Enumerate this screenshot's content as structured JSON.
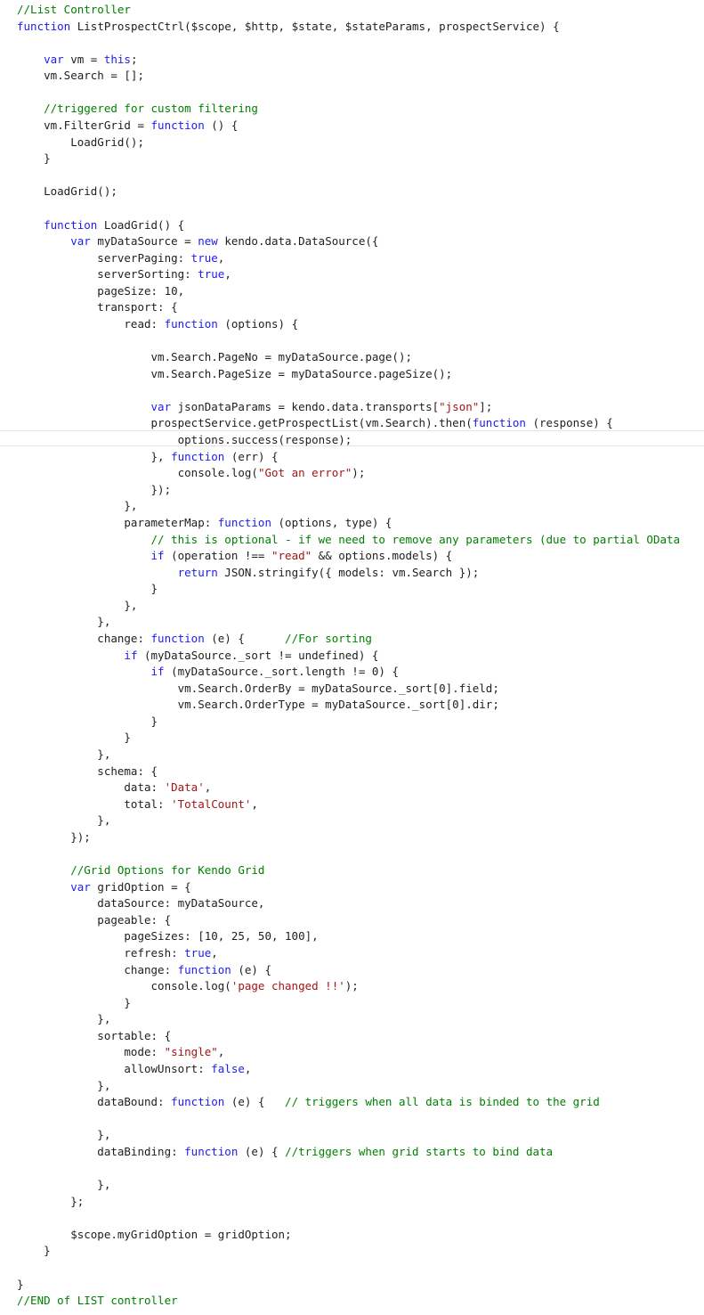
{
  "editor": {
    "colors": {
      "keyword": "#1c1cf0",
      "string": "#a31515",
      "comment": "#008000",
      "plain": "#1e1e1e",
      "background": "#ffffff",
      "current_line_border": "#e6e6e6"
    },
    "current_line_index": 26,
    "lines": [
      [
        {
          "t": "com",
          "v": "//List Controller"
        }
      ],
      [
        {
          "t": "kw",
          "v": "function"
        },
        {
          "t": "pl",
          "v": " ListProspectCtrl($scope, $http, $state, $stateParams, prospectService) {"
        }
      ],
      [],
      [
        {
          "t": "pl",
          "v": "    "
        },
        {
          "t": "kw",
          "v": "var"
        },
        {
          "t": "pl",
          "v": " vm = "
        },
        {
          "t": "kw",
          "v": "this"
        },
        {
          "t": "pl",
          "v": ";"
        }
      ],
      [
        {
          "t": "pl",
          "v": "    vm.Search = [];"
        }
      ],
      [],
      [
        {
          "t": "pl",
          "v": "    "
        },
        {
          "t": "com",
          "v": "//triggered for custom filtering"
        }
      ],
      [
        {
          "t": "pl",
          "v": "    vm.FilterGrid = "
        },
        {
          "t": "kw",
          "v": "function"
        },
        {
          "t": "pl",
          "v": " () {"
        }
      ],
      [
        {
          "t": "pl",
          "v": "        LoadGrid();"
        }
      ],
      [
        {
          "t": "pl",
          "v": "    }"
        }
      ],
      [],
      [
        {
          "t": "pl",
          "v": "    LoadGrid();"
        }
      ],
      [],
      [
        {
          "t": "pl",
          "v": "    "
        },
        {
          "t": "kw",
          "v": "function"
        },
        {
          "t": "pl",
          "v": " LoadGrid() {"
        }
      ],
      [
        {
          "t": "pl",
          "v": "        "
        },
        {
          "t": "kw",
          "v": "var"
        },
        {
          "t": "pl",
          "v": " myDataSource = "
        },
        {
          "t": "kw",
          "v": "new"
        },
        {
          "t": "pl",
          "v": " kendo.data.DataSource({"
        }
      ],
      [
        {
          "t": "pl",
          "v": "            serverPaging: "
        },
        {
          "t": "kw",
          "v": "true"
        },
        {
          "t": "pl",
          "v": ","
        }
      ],
      [
        {
          "t": "pl",
          "v": "            serverSorting: "
        },
        {
          "t": "kw",
          "v": "true"
        },
        {
          "t": "pl",
          "v": ","
        }
      ],
      [
        {
          "t": "pl",
          "v": "            pageSize: 10,"
        }
      ],
      [
        {
          "t": "pl",
          "v": "            transport: {"
        }
      ],
      [
        {
          "t": "pl",
          "v": "                read: "
        },
        {
          "t": "kw",
          "v": "function"
        },
        {
          "t": "pl",
          "v": " (options) {"
        }
      ],
      [],
      [
        {
          "t": "pl",
          "v": "                    vm.Search.PageNo = myDataSource.page();"
        }
      ],
      [
        {
          "t": "pl",
          "v": "                    vm.Search.PageSize = myDataSource.pageSize();"
        }
      ],
      [],
      [
        {
          "t": "pl",
          "v": "                    "
        },
        {
          "t": "kw",
          "v": "var"
        },
        {
          "t": "pl",
          "v": " jsonDataParams = kendo.data.transports["
        },
        {
          "t": "str",
          "v": "\"json\""
        },
        {
          "t": "pl",
          "v": "];"
        }
      ],
      [
        {
          "t": "pl",
          "v": "                    prospectService.getProspectList(vm.Search).then("
        },
        {
          "t": "kw",
          "v": "function"
        },
        {
          "t": "pl",
          "v": " (response) {"
        }
      ],
      [
        {
          "t": "pl",
          "v": "                        options.success(response);"
        }
      ],
      [
        {
          "t": "pl",
          "v": "                    }, "
        },
        {
          "t": "kw",
          "v": "function"
        },
        {
          "t": "pl",
          "v": " (err) {"
        }
      ],
      [
        {
          "t": "pl",
          "v": "                        console.log("
        },
        {
          "t": "str",
          "v": "\"Got an error\""
        },
        {
          "t": "pl",
          "v": ");"
        }
      ],
      [
        {
          "t": "pl",
          "v": "                    });"
        }
      ],
      [
        {
          "t": "pl",
          "v": "                },"
        }
      ],
      [
        {
          "t": "pl",
          "v": "                parameterMap: "
        },
        {
          "t": "kw",
          "v": "function"
        },
        {
          "t": "pl",
          "v": " (options, type) {"
        }
      ],
      [
        {
          "t": "pl",
          "v": "                    "
        },
        {
          "t": "com",
          "v": "// this is optional - if we need to remove any parameters (due to partial OData"
        }
      ],
      [
        {
          "t": "pl",
          "v": "                    "
        },
        {
          "t": "kw",
          "v": "if"
        },
        {
          "t": "pl",
          "v": " (operation !== "
        },
        {
          "t": "str",
          "v": "\"read\""
        },
        {
          "t": "pl",
          "v": " && options.models) {"
        }
      ],
      [
        {
          "t": "pl",
          "v": "                        "
        },
        {
          "t": "kw",
          "v": "return"
        },
        {
          "t": "pl",
          "v": " JSON.stringify({ models: vm.Search });"
        }
      ],
      [
        {
          "t": "pl",
          "v": "                    }"
        }
      ],
      [
        {
          "t": "pl",
          "v": "                },"
        }
      ],
      [
        {
          "t": "pl",
          "v": "            },"
        }
      ],
      [
        {
          "t": "pl",
          "v": "            change: "
        },
        {
          "t": "kw",
          "v": "function"
        },
        {
          "t": "pl",
          "v": " (e) {      "
        },
        {
          "t": "com",
          "v": "//For sorting"
        }
      ],
      [
        {
          "t": "pl",
          "v": "                "
        },
        {
          "t": "kw",
          "v": "if"
        },
        {
          "t": "pl",
          "v": " (myDataSource._sort != undefined) {"
        }
      ],
      [
        {
          "t": "pl",
          "v": "                    "
        },
        {
          "t": "kw",
          "v": "if"
        },
        {
          "t": "pl",
          "v": " (myDataSource._sort.length != 0) {"
        }
      ],
      [
        {
          "t": "pl",
          "v": "                        vm.Search.OrderBy = myDataSource._sort[0].field;"
        }
      ],
      [
        {
          "t": "pl",
          "v": "                        vm.Search.OrderType = myDataSource._sort[0].dir;"
        }
      ],
      [
        {
          "t": "pl",
          "v": "                    }"
        }
      ],
      [
        {
          "t": "pl",
          "v": "                }"
        }
      ],
      [
        {
          "t": "pl",
          "v": "            },"
        }
      ],
      [
        {
          "t": "pl",
          "v": "            schema: {"
        }
      ],
      [
        {
          "t": "pl",
          "v": "                data: "
        },
        {
          "t": "str",
          "v": "'Data'"
        },
        {
          "t": "pl",
          "v": ","
        }
      ],
      [
        {
          "t": "pl",
          "v": "                total: "
        },
        {
          "t": "str",
          "v": "'TotalCount'"
        },
        {
          "t": "pl",
          "v": ","
        }
      ],
      [
        {
          "t": "pl",
          "v": "            },"
        }
      ],
      [
        {
          "t": "pl",
          "v": "        });"
        }
      ],
      [],
      [
        {
          "t": "pl",
          "v": "        "
        },
        {
          "t": "com",
          "v": "//Grid Options for Kendo Grid"
        }
      ],
      [
        {
          "t": "pl",
          "v": "        "
        },
        {
          "t": "kw",
          "v": "var"
        },
        {
          "t": "pl",
          "v": " gridOption = {"
        }
      ],
      [
        {
          "t": "pl",
          "v": "            dataSource: myDataSource,"
        }
      ],
      [
        {
          "t": "pl",
          "v": "            pageable: {"
        }
      ],
      [
        {
          "t": "pl",
          "v": "                pageSizes: [10, 25, 50, 100],"
        }
      ],
      [
        {
          "t": "pl",
          "v": "                refresh: "
        },
        {
          "t": "kw",
          "v": "true"
        },
        {
          "t": "pl",
          "v": ","
        }
      ],
      [
        {
          "t": "pl",
          "v": "                change: "
        },
        {
          "t": "kw",
          "v": "function"
        },
        {
          "t": "pl",
          "v": " (e) {"
        }
      ],
      [
        {
          "t": "pl",
          "v": "                    console.log("
        },
        {
          "t": "str",
          "v": "'page changed !!'"
        },
        {
          "t": "pl",
          "v": ");"
        }
      ],
      [
        {
          "t": "pl",
          "v": "                }"
        }
      ],
      [
        {
          "t": "pl",
          "v": "            },"
        }
      ],
      [
        {
          "t": "pl",
          "v": "            sortable: {"
        }
      ],
      [
        {
          "t": "pl",
          "v": "                mode: "
        },
        {
          "t": "str",
          "v": "\"single\""
        },
        {
          "t": "pl",
          "v": ","
        }
      ],
      [
        {
          "t": "pl",
          "v": "                allowUnsort: "
        },
        {
          "t": "kw",
          "v": "false"
        },
        {
          "t": "pl",
          "v": ","
        }
      ],
      [
        {
          "t": "pl",
          "v": "            },"
        }
      ],
      [
        {
          "t": "pl",
          "v": "            dataBound: "
        },
        {
          "t": "kw",
          "v": "function"
        },
        {
          "t": "pl",
          "v": " (e) {   "
        },
        {
          "t": "com",
          "v": "// triggers when all data is binded to the grid"
        }
      ],
      [],
      [
        {
          "t": "pl",
          "v": "            },"
        }
      ],
      [
        {
          "t": "pl",
          "v": "            dataBinding: "
        },
        {
          "t": "kw",
          "v": "function"
        },
        {
          "t": "pl",
          "v": " (e) { "
        },
        {
          "t": "com",
          "v": "//triggers when grid starts to bind data"
        }
      ],
      [],
      [
        {
          "t": "pl",
          "v": "            },"
        }
      ],
      [
        {
          "t": "pl",
          "v": "        };"
        }
      ],
      [],
      [
        {
          "t": "pl",
          "v": "        $scope.myGridOption = gridOption;"
        }
      ],
      [
        {
          "t": "pl",
          "v": "    }"
        }
      ],
      [],
      [
        {
          "t": "pl",
          "v": "}"
        }
      ],
      [
        {
          "t": "com",
          "v": "//END of LIST controller"
        }
      ]
    ]
  }
}
